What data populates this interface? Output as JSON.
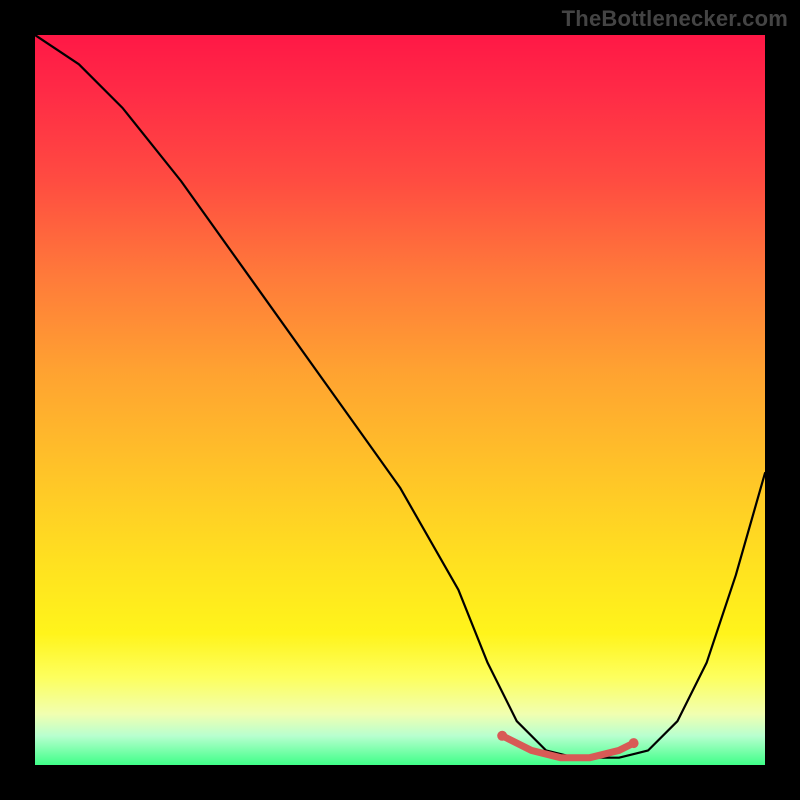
{
  "watermark": "TheBottleneсker.com",
  "chart_data": {
    "type": "line",
    "title": "",
    "xlabel": "",
    "ylabel": "",
    "xlim": [
      0,
      100
    ],
    "ylim": [
      0,
      100
    ],
    "series": [
      {
        "name": "bottleneck-curve",
        "x": [
          0,
          6,
          12,
          20,
          30,
          40,
          50,
          58,
          62,
          66,
          70,
          74,
          78,
          80,
          84,
          88,
          92,
          96,
          100
        ],
        "values": [
          100,
          96,
          90,
          80,
          66,
          52,
          38,
          24,
          14,
          6,
          2,
          1,
          1,
          1,
          2,
          6,
          14,
          26,
          40
        ]
      },
      {
        "name": "minimum-highlight",
        "x": [
          64,
          68,
          72,
          76,
          80,
          82
        ],
        "values": [
          4,
          2,
          1,
          1,
          2,
          3
        ]
      }
    ],
    "gradient_stops": [
      {
        "pos": 0.0,
        "color": "#ff1846"
      },
      {
        "pos": 0.5,
        "color": "#ffb030"
      },
      {
        "pos": 0.85,
        "color": "#fff41b"
      },
      {
        "pos": 1.0,
        "color": "#3fff88"
      }
    ]
  }
}
